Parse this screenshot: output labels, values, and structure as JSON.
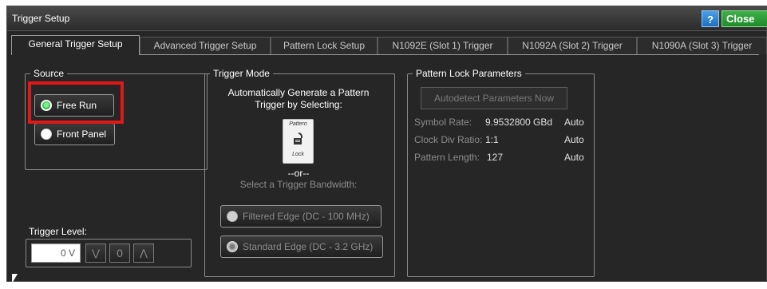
{
  "window": {
    "title": "Trigger Setup",
    "help_label": "?",
    "close_label": "Close"
  },
  "tabs": [
    {
      "label": "General Trigger Setup",
      "active": true
    },
    {
      "label": "Advanced Trigger Setup",
      "active": false
    },
    {
      "label": "Pattern Lock Setup",
      "active": false
    },
    {
      "label": "N1092E (Slot 1) Trigger",
      "active": false
    },
    {
      "label": "N1092A (Slot 2) Trigger",
      "active": false
    },
    {
      "label": "N1090A (Slot 3) Trigger",
      "active": false
    }
  ],
  "source": {
    "legend": "Source",
    "options": [
      {
        "label": "Free Run",
        "selected": true
      },
      {
        "label": "Front Panel",
        "selected": false
      }
    ]
  },
  "trigger_level": {
    "label": "Trigger Level:",
    "value": "0 V",
    "down_icon": "chevron-down-icon",
    "zero_label": "0",
    "up_icon": "chevron-up-icon"
  },
  "trigger_mode": {
    "legend": "Trigger Mode",
    "heading": "Automatically Generate a Pattern Trigger by Selecting:",
    "pattern_top": "Pattern",
    "pattern_bottom": "Lock",
    "or_text": "--or--",
    "bandwidth_text": "Select a Trigger Bandwidth:",
    "options": [
      {
        "label": "Filtered Edge (DC - 100 MHz)",
        "selected": false
      },
      {
        "label": "Standard Edge (DC - 3.2 GHz)",
        "selected": true
      }
    ]
  },
  "pattern_lock": {
    "legend": "Pattern Lock Parameters",
    "autodetect_label": "Autodetect Parameters Now",
    "symbol_rate_label": "Symbol Rate:",
    "symbol_rate_value": "9.9532800 GBd",
    "symbol_rate_mode": "Auto",
    "clock_div_label": "Clock Div Ratio:",
    "clock_div_value": "1:1",
    "clock_div_mode": "Auto",
    "pattern_length_label": "Pattern Length:",
    "pattern_length_value": "127",
    "pattern_length_mode": "Auto"
  },
  "colors": {
    "window_bg": "#262626",
    "selected_radio": "#2ab84a",
    "highlight": "#e01818",
    "help_button": "#1f6fc0",
    "close_button": "#1f8a2a"
  }
}
